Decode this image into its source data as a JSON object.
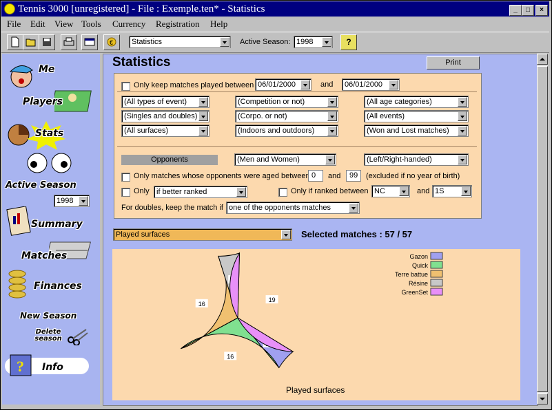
{
  "window": {
    "title": "Tennis 3000 [unregistered] - File : Exemple.ten* - Statistics"
  },
  "menu": [
    "File",
    "Edit",
    "View",
    "Tools",
    "Currency",
    "Registration",
    "Help"
  ],
  "toolbar": {
    "view_select": "Statistics",
    "active_season_label": "Active Season:",
    "active_season": "1998",
    "help_icon": "?"
  },
  "sidebar": {
    "items": [
      {
        "label": "Me",
        "icon": "cap-icon"
      },
      {
        "label": "Players",
        "icon": "players-icon"
      },
      {
        "label": "Stats",
        "icon": "pie-chart-icon"
      },
      {
        "label": "Active Season",
        "icon": "eyes-icon"
      },
      {
        "label": "Summary",
        "icon": "document-icon"
      },
      {
        "label": "Matches",
        "icon": "matches-icon"
      },
      {
        "label": "Finances",
        "icon": "coins-icon"
      },
      {
        "label": "New Season",
        "icon": ""
      },
      {
        "label": "Delete season",
        "icon": "scissors-icon"
      },
      {
        "label": "Info",
        "icon": "question-icon"
      }
    ],
    "season_value": "1998"
  },
  "main": {
    "title": "Statistics",
    "print_button": "Print",
    "filters": {
      "date_check_label": "Only keep matches played between",
      "date_from": "06/01/2000",
      "and1": "and",
      "date_to": "06/01/2000",
      "combos": [
        "(All types of event)",
        "(Competition or not)",
        "(All age categories)",
        "(Singles and doubles)",
        "(Corpo. or not)",
        "(All events)",
        "(All surfaces)",
        "(Indoors and outdoors)",
        "(Won and Lost matches)"
      ],
      "opponents_label": "Opponents",
      "gender": "(Men and Women)",
      "handed": "(Left/Right-handed)",
      "aged_label": "Only matches whose opponents were aged between",
      "age_from": "0",
      "and2": "and",
      "age_to": "99",
      "aged_note": "(excluded if no year of birth)",
      "only_label": "Only",
      "ranked_select": "if better ranked",
      "ranked_between_label": "Only if ranked between",
      "rank_from": "NC",
      "and3": "and",
      "rank_to": "1S",
      "doubles_label": "For doubles, keep the match if",
      "doubles_select": "one of the opponents matches"
    },
    "chart_selector": "Played surfaces",
    "selected_matches": "Selected matches : 57 / 57"
  },
  "chart_data": {
    "type": "pie",
    "title": "Played surfaces",
    "slices": [
      {
        "label": "Gazon",
        "value": 3,
        "color": "#a0a0f0"
      },
      {
        "label": "Quick",
        "value": 16,
        "color": "#80e090"
      },
      {
        "label": "Terre battue",
        "value": 16,
        "color": "#f0c070"
      },
      {
        "label": "Résine",
        "value": 3,
        "color": "#c8c8c8"
      },
      {
        "label": "GreenSet",
        "value": 19,
        "color": "#e890f8"
      }
    ],
    "legend_position": "top-right"
  }
}
